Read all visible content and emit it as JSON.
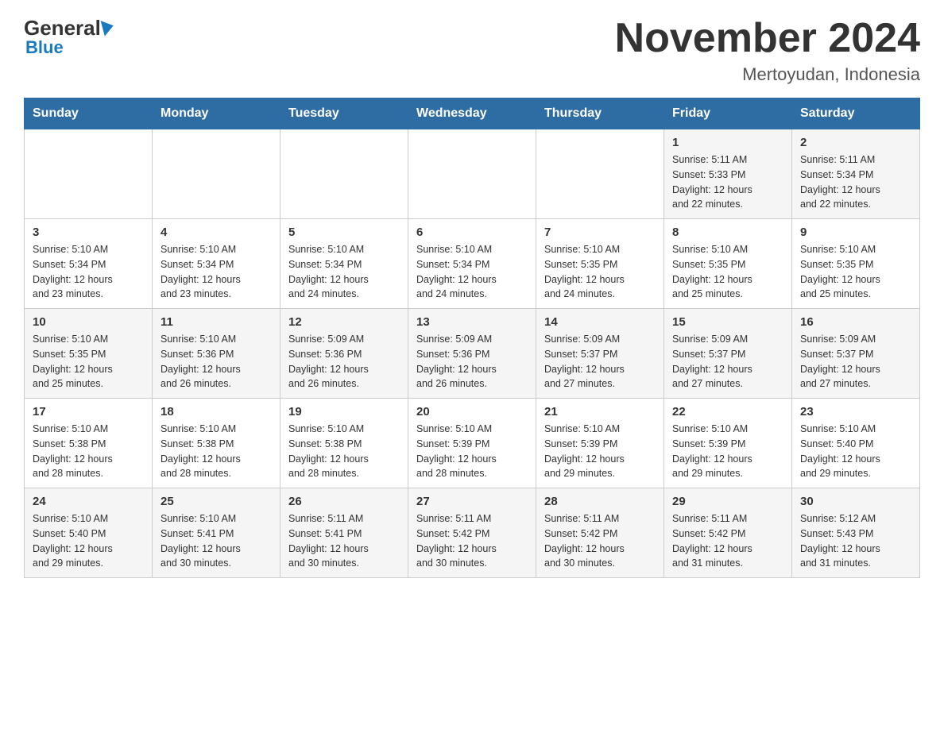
{
  "header": {
    "logo": {
      "general": "General",
      "blue": "Blue"
    },
    "title": "November 2024",
    "subtitle": "Mertoyudan, Indonesia"
  },
  "calendar": {
    "days_of_week": [
      "Sunday",
      "Monday",
      "Tuesday",
      "Wednesday",
      "Thursday",
      "Friday",
      "Saturday"
    ],
    "weeks": [
      {
        "row_class": "row-1",
        "days": [
          {
            "number": "",
            "info": ""
          },
          {
            "number": "",
            "info": ""
          },
          {
            "number": "",
            "info": ""
          },
          {
            "number": "",
            "info": ""
          },
          {
            "number": "",
            "info": ""
          },
          {
            "number": "1",
            "info": "Sunrise: 5:11 AM\nSunset: 5:33 PM\nDaylight: 12 hours\nand 22 minutes."
          },
          {
            "number": "2",
            "info": "Sunrise: 5:11 AM\nSunset: 5:34 PM\nDaylight: 12 hours\nand 22 minutes."
          }
        ]
      },
      {
        "row_class": "row-2",
        "days": [
          {
            "number": "3",
            "info": "Sunrise: 5:10 AM\nSunset: 5:34 PM\nDaylight: 12 hours\nand 23 minutes."
          },
          {
            "number": "4",
            "info": "Sunrise: 5:10 AM\nSunset: 5:34 PM\nDaylight: 12 hours\nand 23 minutes."
          },
          {
            "number": "5",
            "info": "Sunrise: 5:10 AM\nSunset: 5:34 PM\nDaylight: 12 hours\nand 24 minutes."
          },
          {
            "number": "6",
            "info": "Sunrise: 5:10 AM\nSunset: 5:34 PM\nDaylight: 12 hours\nand 24 minutes."
          },
          {
            "number": "7",
            "info": "Sunrise: 5:10 AM\nSunset: 5:35 PM\nDaylight: 12 hours\nand 24 minutes."
          },
          {
            "number": "8",
            "info": "Sunrise: 5:10 AM\nSunset: 5:35 PM\nDaylight: 12 hours\nand 25 minutes."
          },
          {
            "number": "9",
            "info": "Sunrise: 5:10 AM\nSunset: 5:35 PM\nDaylight: 12 hours\nand 25 minutes."
          }
        ]
      },
      {
        "row_class": "row-3",
        "days": [
          {
            "number": "10",
            "info": "Sunrise: 5:10 AM\nSunset: 5:35 PM\nDaylight: 12 hours\nand 25 minutes."
          },
          {
            "number": "11",
            "info": "Sunrise: 5:10 AM\nSunset: 5:36 PM\nDaylight: 12 hours\nand 26 minutes."
          },
          {
            "number": "12",
            "info": "Sunrise: 5:09 AM\nSunset: 5:36 PM\nDaylight: 12 hours\nand 26 minutes."
          },
          {
            "number": "13",
            "info": "Sunrise: 5:09 AM\nSunset: 5:36 PM\nDaylight: 12 hours\nand 26 minutes."
          },
          {
            "number": "14",
            "info": "Sunrise: 5:09 AM\nSunset: 5:37 PM\nDaylight: 12 hours\nand 27 minutes."
          },
          {
            "number": "15",
            "info": "Sunrise: 5:09 AM\nSunset: 5:37 PM\nDaylight: 12 hours\nand 27 minutes."
          },
          {
            "number": "16",
            "info": "Sunrise: 5:09 AM\nSunset: 5:37 PM\nDaylight: 12 hours\nand 27 minutes."
          }
        ]
      },
      {
        "row_class": "row-4",
        "days": [
          {
            "number": "17",
            "info": "Sunrise: 5:10 AM\nSunset: 5:38 PM\nDaylight: 12 hours\nand 28 minutes."
          },
          {
            "number": "18",
            "info": "Sunrise: 5:10 AM\nSunset: 5:38 PM\nDaylight: 12 hours\nand 28 minutes."
          },
          {
            "number": "19",
            "info": "Sunrise: 5:10 AM\nSunset: 5:38 PM\nDaylight: 12 hours\nand 28 minutes."
          },
          {
            "number": "20",
            "info": "Sunrise: 5:10 AM\nSunset: 5:39 PM\nDaylight: 12 hours\nand 28 minutes."
          },
          {
            "number": "21",
            "info": "Sunrise: 5:10 AM\nSunset: 5:39 PM\nDaylight: 12 hours\nand 29 minutes."
          },
          {
            "number": "22",
            "info": "Sunrise: 5:10 AM\nSunset: 5:39 PM\nDaylight: 12 hours\nand 29 minutes."
          },
          {
            "number": "23",
            "info": "Sunrise: 5:10 AM\nSunset: 5:40 PM\nDaylight: 12 hours\nand 29 minutes."
          }
        ]
      },
      {
        "row_class": "row-5",
        "days": [
          {
            "number": "24",
            "info": "Sunrise: 5:10 AM\nSunset: 5:40 PM\nDaylight: 12 hours\nand 29 minutes."
          },
          {
            "number": "25",
            "info": "Sunrise: 5:10 AM\nSunset: 5:41 PM\nDaylight: 12 hours\nand 30 minutes."
          },
          {
            "number": "26",
            "info": "Sunrise: 5:11 AM\nSunset: 5:41 PM\nDaylight: 12 hours\nand 30 minutes."
          },
          {
            "number": "27",
            "info": "Sunrise: 5:11 AM\nSunset: 5:42 PM\nDaylight: 12 hours\nand 30 minutes."
          },
          {
            "number": "28",
            "info": "Sunrise: 5:11 AM\nSunset: 5:42 PM\nDaylight: 12 hours\nand 30 minutes."
          },
          {
            "number": "29",
            "info": "Sunrise: 5:11 AM\nSunset: 5:42 PM\nDaylight: 12 hours\nand 31 minutes."
          },
          {
            "number": "30",
            "info": "Sunrise: 5:12 AM\nSunset: 5:43 PM\nDaylight: 12 hours\nand 31 minutes."
          }
        ]
      }
    ]
  }
}
